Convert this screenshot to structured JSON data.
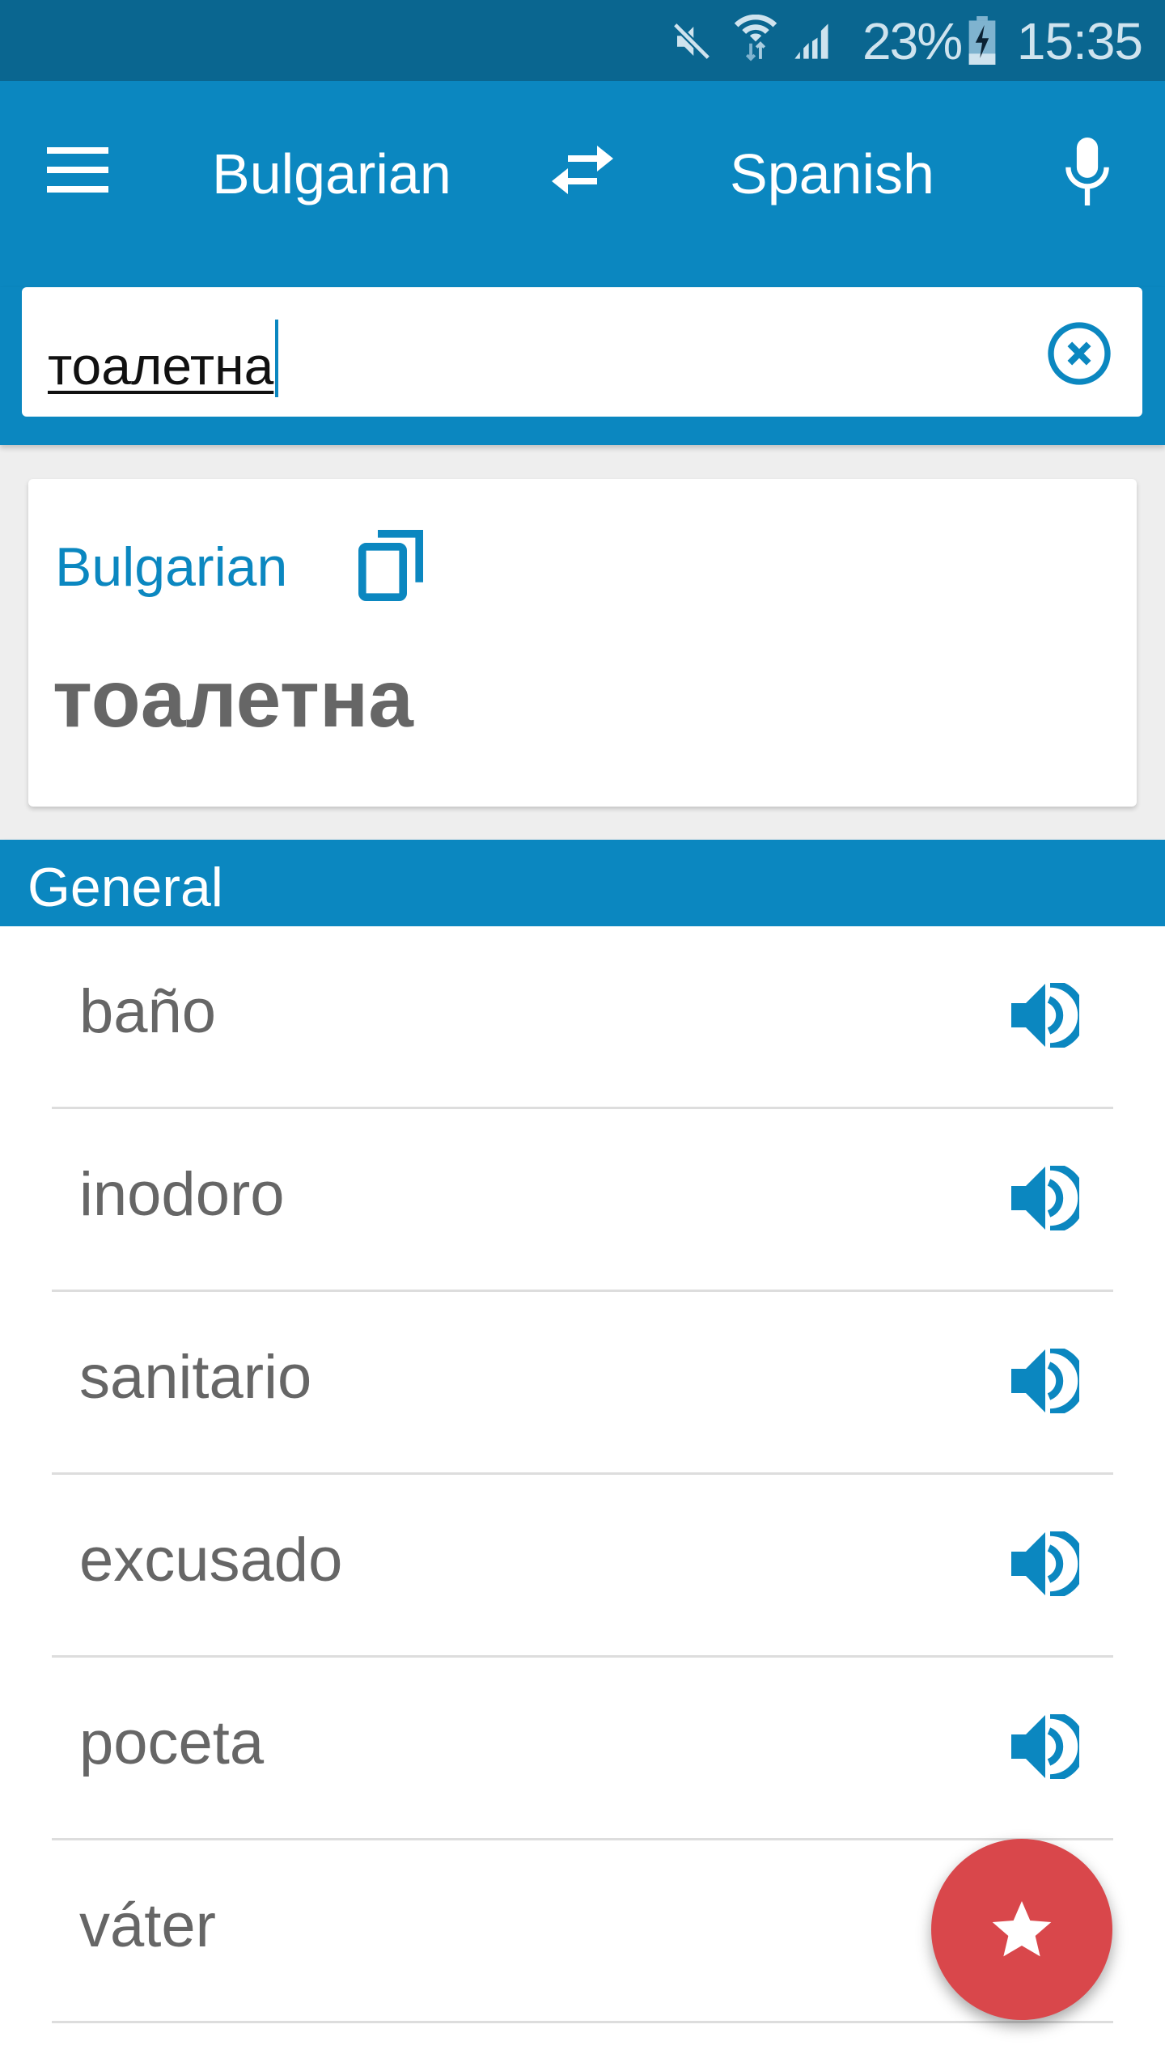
{
  "status_bar": {
    "icons": [
      "mute-icon",
      "wifi-icon",
      "signal-icon",
      "battery-charging-icon"
    ],
    "battery_percent": "23%",
    "time": "15:35"
  },
  "toolbar": {
    "menu_icon": "hamburger-menu-icon",
    "source_language": "Bulgarian",
    "swap_icon": "swap-arrows-icon",
    "target_language": "Spanish",
    "mic_icon": "microphone-icon"
  },
  "search": {
    "value": "тоалетна",
    "placeholder": "",
    "clear_icon": "clear-circle-icon"
  },
  "card": {
    "language": "Bulgarian",
    "copy_icon": "copy-icon",
    "word": "тоалетна"
  },
  "section": {
    "title": "General"
  },
  "translations": [
    {
      "word": "baño",
      "icon": "speaker-icon"
    },
    {
      "word": "inodoro",
      "icon": "speaker-icon"
    },
    {
      "word": "sanitario",
      "icon": "speaker-icon"
    },
    {
      "word": "excusado",
      "icon": "speaker-icon"
    },
    {
      "word": "poceta",
      "icon": "speaker-icon"
    },
    {
      "word": "váter",
      "icon": ""
    }
  ],
  "fab": {
    "icon": "star-icon"
  },
  "colors": {
    "primary": "#0b87c0",
    "status_bar": "#0a6690",
    "fab": "#d9474b",
    "text_gray": "#666666"
  }
}
